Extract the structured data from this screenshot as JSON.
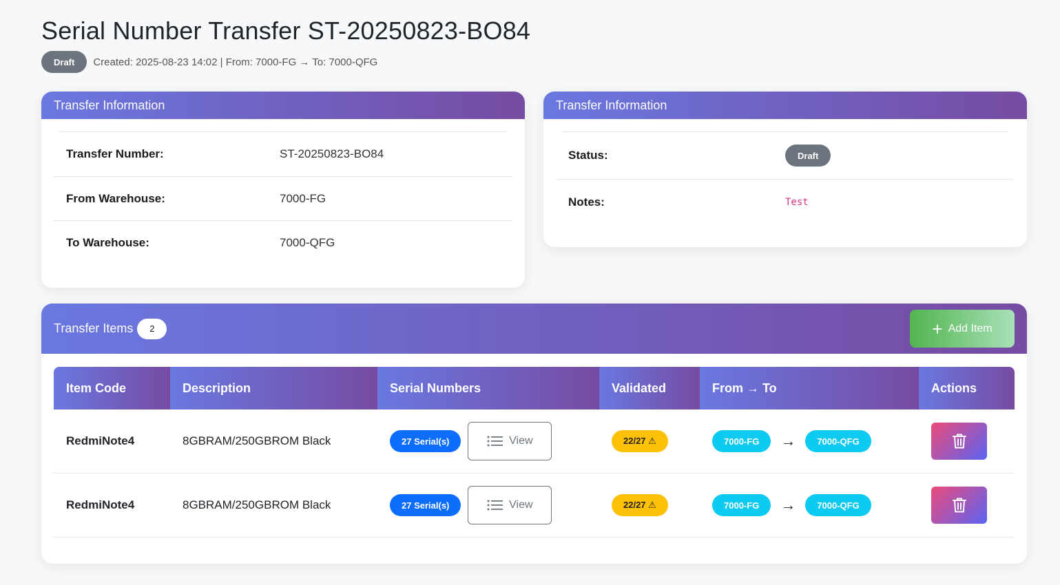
{
  "page": {
    "title": "Serial Number Transfer ST-20250823-BO84",
    "status_badge": "Draft",
    "meta": "Created: 2025-08-23 14:02 | From: 7000-FG → To: 7000-QFG"
  },
  "left_card": {
    "title": "Transfer Information",
    "rows": [
      {
        "label": "Transfer Number:",
        "value": "ST-20250823-BO84"
      },
      {
        "label": "From Warehouse:",
        "value": "7000-FG"
      },
      {
        "label": "To Warehouse:",
        "value": "7000-QFG"
      }
    ]
  },
  "right_card": {
    "title": "Transfer Information",
    "status_label": "Status:",
    "status_value": "Draft",
    "notes_label": "Notes:",
    "notes_value": "Test"
  },
  "items": {
    "title": "Transfer Items",
    "count": "2",
    "add_label": "Add Item",
    "columns": [
      "Item Code",
      "Description",
      "Serial Numbers",
      "Validated",
      "From → To",
      "Actions"
    ],
    "rows": [
      {
        "code": "RedmiNote4",
        "description": "8GBRAM/250GBROM Black",
        "serials": "27 Serial(s)",
        "view": "View",
        "validated": "22/27 ⚠",
        "from": "7000-FG",
        "to": "7000-QFG"
      },
      {
        "code": "RedmiNote4",
        "description": "8GBRAM/250GBROM Black",
        "serials": "27 Serial(s)",
        "view": "View",
        "validated": "22/27 ⚠",
        "from": "7000-FG",
        "to": "7000-QFG"
      }
    ]
  },
  "colors": {
    "header_gradient_start": "#6a78e0",
    "header_gradient_end": "#764ba2",
    "draft": "#6c757d",
    "serial_pill": "#0d6efd",
    "validated_pill": "#ffc107",
    "warehouse_pill": "#0dcaf0"
  }
}
